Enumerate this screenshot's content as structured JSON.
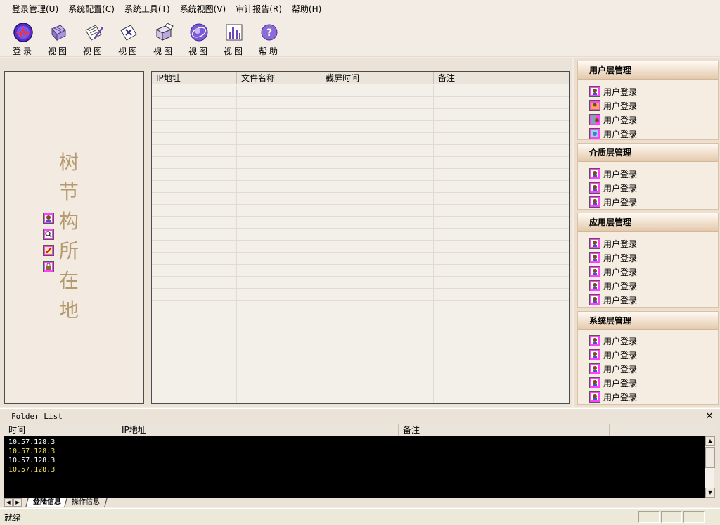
{
  "menu": [
    {
      "label": "登录管理(U)"
    },
    {
      "label": "系统配置(C)"
    },
    {
      "label": "系统工具(T)"
    },
    {
      "label": "系统视图(V)"
    },
    {
      "label": "审计报告(R)"
    },
    {
      "label": "帮助(H)"
    }
  ],
  "toolbar": [
    {
      "label": "登录",
      "icon": "login-wave-icon"
    },
    {
      "label": "视图",
      "icon": "grid-cube-icon"
    },
    {
      "label": "视图",
      "icon": "notepad-pencil-icon"
    },
    {
      "label": "视图",
      "icon": "x-document-icon"
    },
    {
      "label": "视图",
      "icon": "open-box-icon"
    },
    {
      "label": "视图",
      "icon": "purple-globe-icon"
    },
    {
      "label": "视图",
      "icon": "bar-chart-icon"
    },
    {
      "label": "帮助",
      "icon": "help-question-icon"
    }
  ],
  "tree": {
    "chars": [
      "树",
      "节",
      "构",
      "所",
      "在",
      "地"
    ],
    "icons": [
      "user-icon",
      "search-icon",
      "edit-icon",
      "lock-icon"
    ]
  },
  "grid": {
    "columns": [
      "IP地址",
      "文件名称",
      "截屏时间",
      "备注"
    ]
  },
  "groups": [
    {
      "title": "用户层管理",
      "items": [
        "用户登录",
        "用户登录",
        "用户登录",
        "用户登录"
      ]
    },
    {
      "title": "介质层管理",
      "items": [
        "用户登录",
        "用户登录",
        "用户登录"
      ]
    },
    {
      "title": "应用层管理",
      "items": [
        "用户登录",
        "用户登录",
        "用户登录",
        "用户登录",
        "用户登录"
      ]
    },
    {
      "title": "系统层管理",
      "items": [
        "用户登录",
        "用户登录",
        "用户登录",
        "用户登录",
        "用户登录"
      ]
    }
  ],
  "folder_list": {
    "title": "Folder List",
    "close": "✕",
    "columns": [
      "时间",
      "IP地址",
      "备注"
    ],
    "rows": [
      {
        "text": "10.57.128.3",
        "color": "#ffffff"
      },
      {
        "text": "10.57.128.3",
        "color": "#f0e060"
      },
      {
        "text": "10.57.128.3",
        "color": "#ffffff"
      },
      {
        "text": "10.57.128.3",
        "color": "#f0e060"
      }
    ],
    "tabs": [
      "登陆信息",
      "操作信息"
    ]
  },
  "status": {
    "text": "就绪"
  },
  "colors": {
    "accent_tree_text": "#b59a6e",
    "log_bg": "#000000",
    "group_header": "#e4c9ad"
  }
}
